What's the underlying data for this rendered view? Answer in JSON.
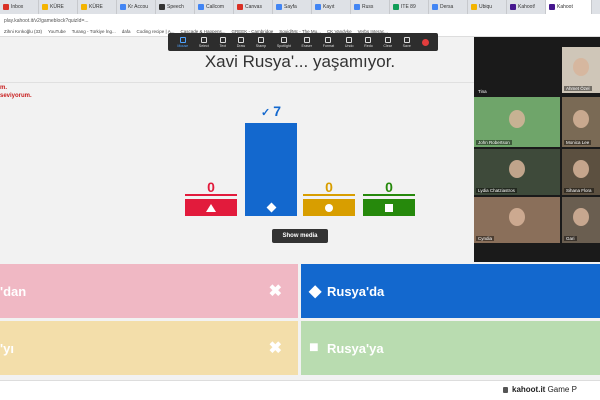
{
  "browser": {
    "tabs": [
      "Inbox",
      "KÜRE",
      "KÜRE",
      "Kr Accou",
      "Speech",
      "Callcom",
      "Canvas",
      "Sayfa",
      "Kayıt",
      "Russ",
      "ITE 89",
      "Dersa",
      "Ubiqu",
      "Kahoot!",
      "Kahoot"
    ],
    "active_tab": "Kahoot",
    "address": "play.kahoot.it/v2/gameblock?quizId=...",
    "bookmarks": [
      "Zihni Kırıkoğlu (33)",
      "YouTube",
      "Turang - Türkiye İng...",
      "dafa",
      "Coding recipe | A...",
      "Cascade & Happens...",
      "GREEK - Cambridge",
      "Squid/Mc - The Mu...",
      "CK Vandyke",
      "Verbs Interac..."
    ]
  },
  "zoom_toolbar": {
    "tools": [
      "Mouse",
      "Select",
      "Text",
      "Draw",
      "Stamp",
      "Spotlight",
      "Eraser",
      "Format",
      "Undo",
      "Redo",
      "Clear",
      "Save"
    ],
    "selected": "Mouse"
  },
  "left_text": [
    "m.",
    "seviyorum."
  ],
  "question": "Xavi Rusya'... yaşamıyor.",
  "results": [
    {
      "count": "0",
      "color": "#e21b3c",
      "shape": "triangle",
      "correct": false
    },
    {
      "count": "7",
      "color": "#1368ce",
      "shape": "diamond",
      "correct": true
    },
    {
      "count": "0",
      "color": "#d89e00",
      "shape": "circle",
      "correct": false
    },
    {
      "count": "0",
      "color": "#26890c",
      "shape": "square",
      "correct": false
    }
  ],
  "correct_mark": "✓",
  "show_media": "Show media",
  "answers": [
    {
      "text": "'dan",
      "color": "#f0b8c4",
      "mark": "✖"
    },
    {
      "text": "Rusya'da",
      "color": "#1368ce",
      "mark": "◆"
    },
    {
      "text": "'yı",
      "color": "#f3deaa",
      "mark": "✖"
    },
    {
      "text": "Rusya'ya",
      "color": "#b9dcb0",
      "mark": "■"
    }
  ],
  "participants": [
    "Ahmet Özel",
    "Tina",
    "John Robertson",
    "Monica Lee",
    "Lydia Chatziastros",
    "Sihana Flora",
    "Cyndia",
    "Gari"
  ],
  "footer": {
    "domain": "kahoot.it",
    "suffix": "Game P"
  }
}
